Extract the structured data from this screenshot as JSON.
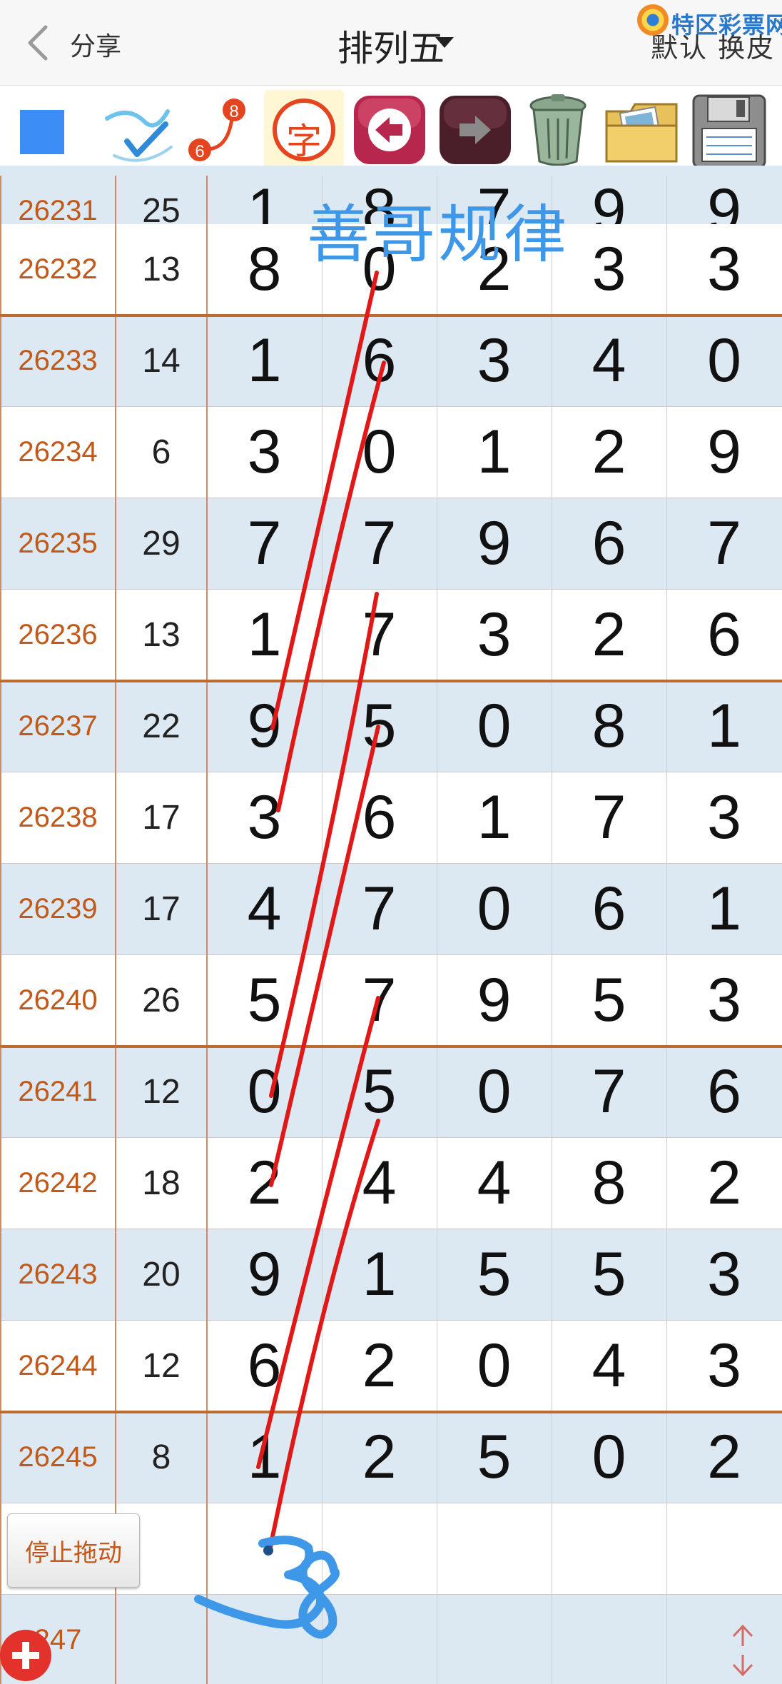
{
  "header": {
    "share_label": "分享",
    "title": "排列五",
    "skin_label": "默认 换皮",
    "brand_text": "特区彩票网"
  },
  "toolbar": {
    "tools": [
      {
        "icon": "color-square-icon",
        "color": "#3d8df6"
      },
      {
        "icon": "pen-check-icon"
      },
      {
        "icon": "connect-dots-icon",
        "badge_start": "6",
        "badge_end": "8"
      },
      {
        "icon": "font-icon",
        "glyph": "字"
      },
      {
        "icon": "undo-arrow-icon"
      },
      {
        "icon": "redo-arrow-icon"
      },
      {
        "icon": "trash-bin-icon"
      },
      {
        "icon": "photo-folder-icon"
      },
      {
        "icon": "floppy-disk-icon"
      }
    ]
  },
  "annotation": {
    "title": "善哥规律",
    "prediction": "38"
  },
  "table": {
    "rows": [
      {
        "issue": "26231",
        "sum": "25",
        "digits": [
          "1",
          "8",
          "7",
          "9",
          "9"
        ]
      },
      {
        "issue": "26232",
        "sum": "13",
        "digits": [
          "8",
          "0",
          "2",
          "3",
          "3"
        ]
      },
      {
        "issue": "26233",
        "sum": "14",
        "digits": [
          "1",
          "6",
          "3",
          "4",
          "0"
        ]
      },
      {
        "issue": "26234",
        "sum": "6",
        "digits": [
          "3",
          "0",
          "1",
          "2",
          "9"
        ]
      },
      {
        "issue": "26235",
        "sum": "29",
        "digits": [
          "7",
          "7",
          "9",
          "6",
          "7"
        ]
      },
      {
        "issue": "26236",
        "sum": "13",
        "digits": [
          "1",
          "7",
          "3",
          "2",
          "6"
        ]
      },
      {
        "issue": "26237",
        "sum": "22",
        "digits": [
          "9",
          "5",
          "0",
          "8",
          "1"
        ]
      },
      {
        "issue": "26238",
        "sum": "17",
        "digits": [
          "3",
          "6",
          "1",
          "7",
          "3"
        ]
      },
      {
        "issue": "26239",
        "sum": "17",
        "digits": [
          "4",
          "7",
          "0",
          "6",
          "1"
        ]
      },
      {
        "issue": "26240",
        "sum": "26",
        "digits": [
          "5",
          "7",
          "9",
          "5",
          "3"
        ]
      },
      {
        "issue": "26241",
        "sum": "12",
        "digits": [
          "0",
          "5",
          "0",
          "7",
          "6"
        ]
      },
      {
        "issue": "26242",
        "sum": "18",
        "digits": [
          "2",
          "4",
          "4",
          "8",
          "2"
        ]
      },
      {
        "issue": "26243",
        "sum": "20",
        "digits": [
          "9",
          "1",
          "5",
          "5",
          "3"
        ]
      },
      {
        "issue": "26244",
        "sum": "12",
        "digits": [
          "6",
          "2",
          "0",
          "4",
          "3"
        ]
      },
      {
        "issue": "26245",
        "sum": "8",
        "digits": [
          "1",
          "2",
          "5",
          "0",
          "2"
        ]
      },
      {
        "issue": "",
        "sum": "",
        "digits": [
          "",
          "",
          "",
          "",
          ""
        ]
      },
      {
        "issue": "247",
        "sum": "",
        "digits": [
          "",
          "",
          "",
          "",
          ""
        ]
      }
    ]
  },
  "buttons": {
    "stop_drag": "停止拖动"
  },
  "colors": {
    "issue_text": "#c2591a",
    "row_alt": "#dde9f2",
    "group_divider": "#c06a30",
    "handwriting_red": "#e01818",
    "handwriting_blue": "#3f97e8"
  }
}
